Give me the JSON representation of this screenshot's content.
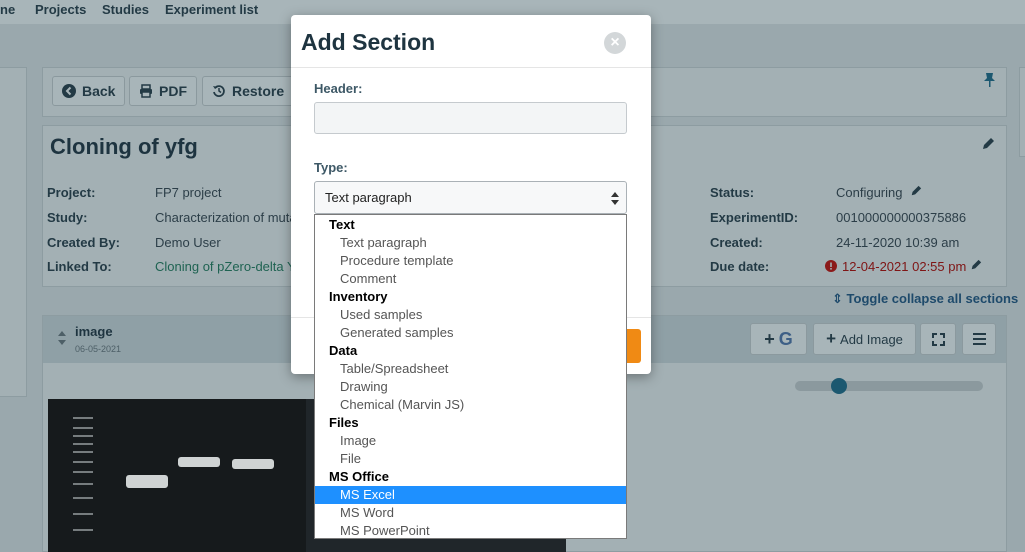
{
  "nav": {
    "items": [
      "ne",
      "Projects",
      "Studies",
      "Experiment list"
    ]
  },
  "toolbar": {
    "back": "Back",
    "pdf": "PDF",
    "restore": "Restore"
  },
  "experiment": {
    "title": "Cloning of yfg",
    "fields_left": [
      {
        "label": "Project:",
        "value": "FP7 project"
      },
      {
        "label": "Study:",
        "value": "Characterization of muta"
      },
      {
        "label": "Created By:",
        "value": "Demo User"
      },
      {
        "label": "Linked To:",
        "value": "Cloning of pZero-delta Y"
      }
    ],
    "fields_right": [
      {
        "label": "Status:",
        "value": "Configuring"
      },
      {
        "label": "ExperimentID:",
        "value": "001000000000375886"
      },
      {
        "label": "Created:",
        "value": "24-11-2020 10:39 am"
      },
      {
        "label": "Due date:",
        "value": "12-04-2021 02:55 pm"
      }
    ],
    "toggle_all": "Toggle collapse all sections"
  },
  "section": {
    "title": "image",
    "date": "06-05-2021",
    "add_image": "Add Image",
    "slider_value": 0.2
  },
  "modal": {
    "title": "Add Section",
    "close": "×",
    "header_label": "Header:",
    "header_value": "",
    "type_label": "Type:",
    "type_value": "Text paragraph"
  },
  "dropdown": {
    "rows": [
      {
        "kind": "group",
        "label": "Text"
      },
      {
        "kind": "option",
        "label": "Text paragraph"
      },
      {
        "kind": "option",
        "label": "Procedure template"
      },
      {
        "kind": "option",
        "label": "Comment"
      },
      {
        "kind": "group",
        "label": "Inventory"
      },
      {
        "kind": "option",
        "label": "Used samples"
      },
      {
        "kind": "option",
        "label": "Generated samples"
      },
      {
        "kind": "group",
        "label": "Data"
      },
      {
        "kind": "option",
        "label": "Table/Spreadsheet"
      },
      {
        "kind": "option",
        "label": "Drawing"
      },
      {
        "kind": "option",
        "label": "Chemical (Marvin JS)"
      },
      {
        "kind": "group",
        "label": "Files"
      },
      {
        "kind": "option",
        "label": "Image"
      },
      {
        "kind": "option",
        "label": "File"
      },
      {
        "kind": "group",
        "label": "MS Office"
      },
      {
        "kind": "option",
        "label": "MS Excel",
        "selected": true
      },
      {
        "kind": "option",
        "label": "MS Word"
      },
      {
        "kind": "option",
        "label": "MS PowerPoint"
      }
    ]
  },
  "colors": {
    "highlight": "#1e90ff",
    "accent_orange": "#f08a14",
    "title": "#1e3440"
  }
}
